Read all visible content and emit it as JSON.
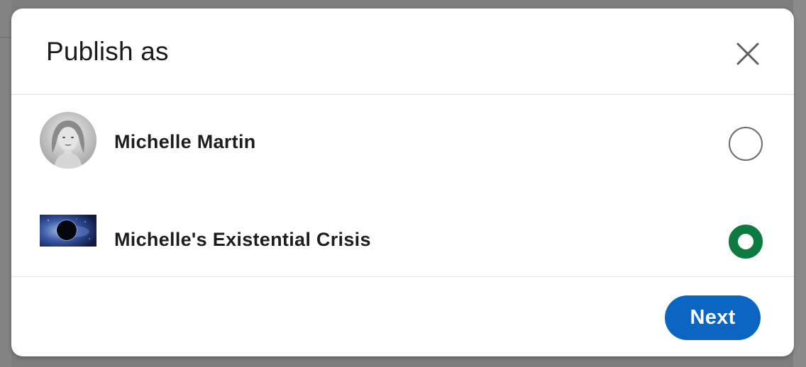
{
  "dialog": {
    "title": "Publish as",
    "close_icon": "close-icon",
    "options": [
      {
        "name": "Michelle Martin",
        "kind": "profile",
        "selected": false
      },
      {
        "name": "Michelle's Existential Crisis",
        "kind": "page",
        "selected": true
      }
    ],
    "next_label": "Next"
  },
  "colors": {
    "accent": "#0a66c2",
    "selected_radio": "#0d7a3f",
    "backdrop": "#7d7d7d"
  }
}
